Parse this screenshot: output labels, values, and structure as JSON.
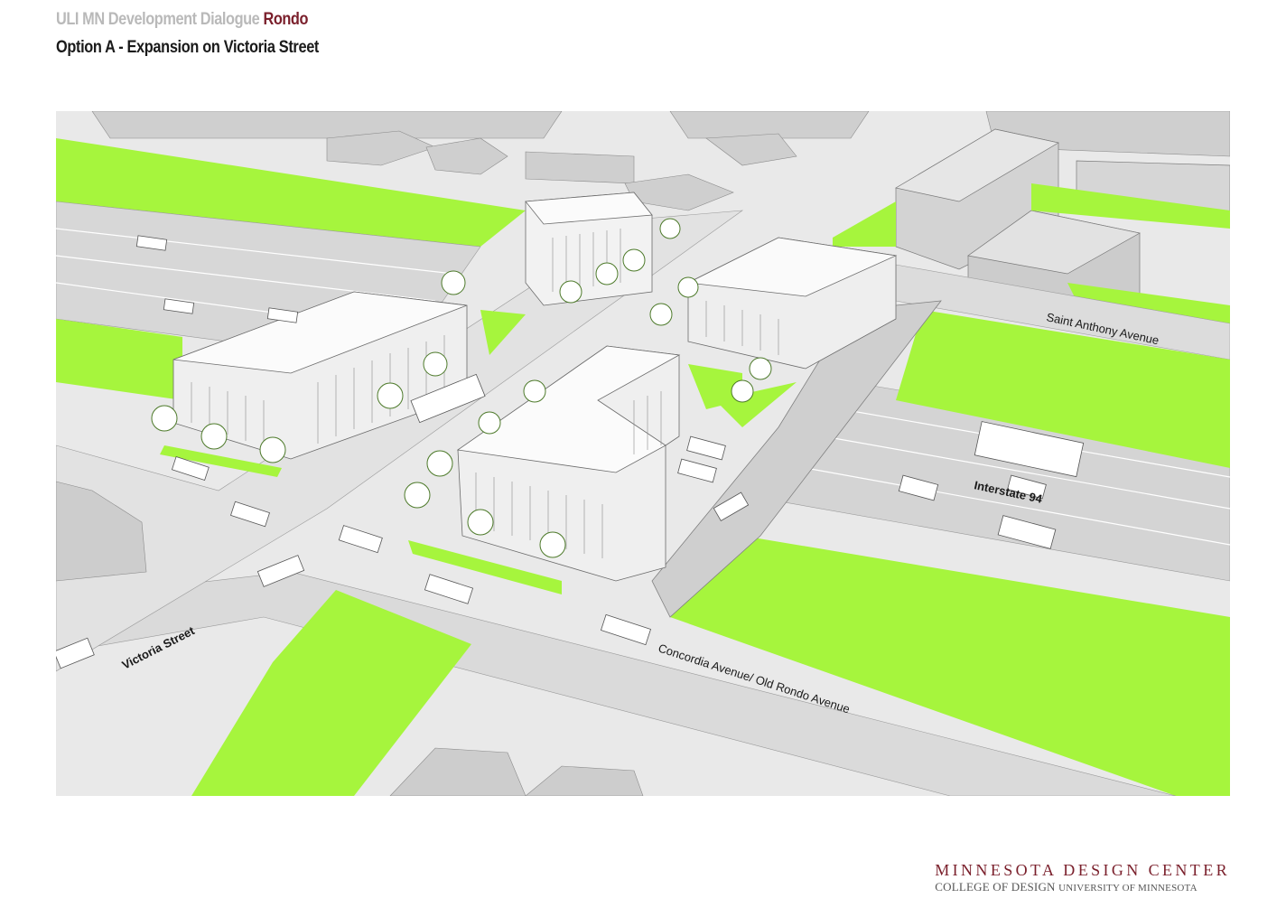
{
  "header": {
    "series_title": "ULI MN Development Dialogue",
    "project_name": "Rondo",
    "option_title": "Option A - Expansion on Victoria Street"
  },
  "colors": {
    "green_space": "#a6f53d",
    "road": "#dedede",
    "building": "#f7f7f7",
    "accent": "#7a1f2b"
  },
  "street_labels": {
    "victoria": "Victoria Street",
    "concordia": "Concordia Avenue/ Old Rondo Avenue",
    "saint_anthony": "Saint Anthony Avenue",
    "interstate": "Interstate 94"
  },
  "footer": {
    "center_name": "MINNESOTA DESIGN CENTER",
    "college_line": "COLLEGE OF DESIGN",
    "university_line": "UNIVERSITY OF MINNESOTA"
  }
}
